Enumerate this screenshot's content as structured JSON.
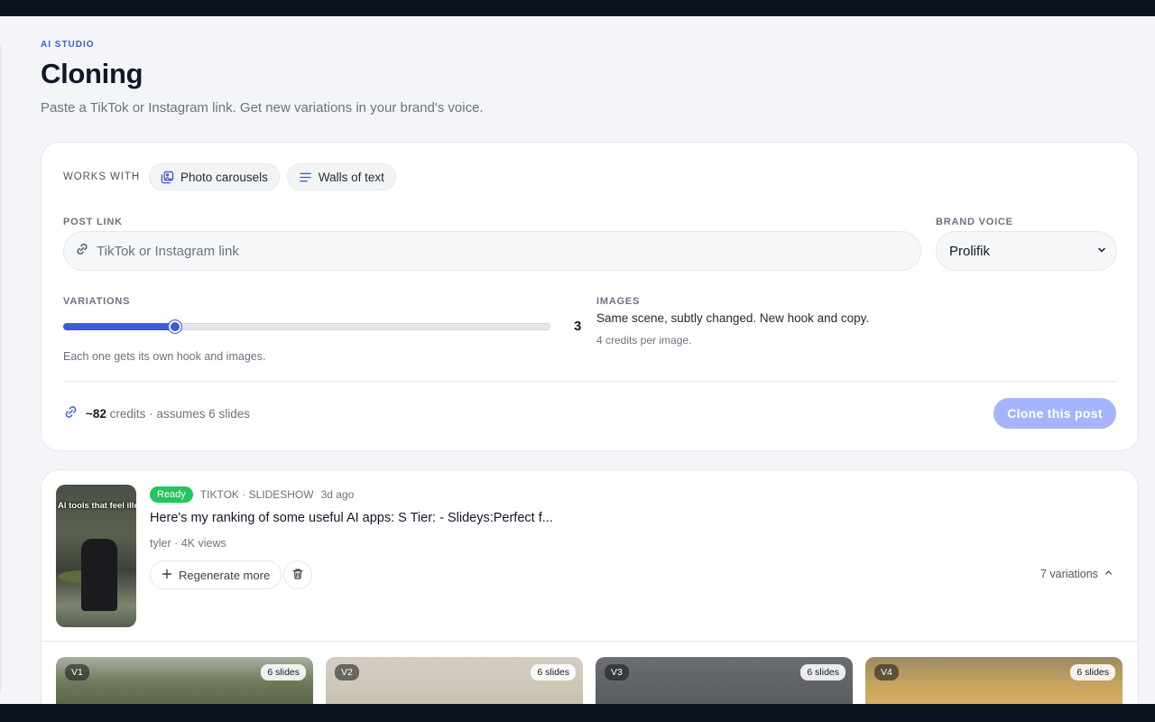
{
  "header": {
    "eyebrow": "AI STUDIO",
    "title": "Cloning",
    "subtitle": "Paste a TikTok or Instagram link. Get new variations in your brand's voice."
  },
  "form": {
    "works_with_label": "WORKS WITH",
    "chips": [
      {
        "label": "Photo carousels",
        "icon": "photo-carousel-icon"
      },
      {
        "label": "Walls of text",
        "icon": "text-lines-icon"
      }
    ],
    "post_link": {
      "label": "POST LINK",
      "value": "",
      "placeholder": "TikTok or Instagram link",
      "icon": "link-icon"
    },
    "brand_voice": {
      "label": "BRAND VOICE",
      "selected": "Prolifik",
      "icon": "chevron-down-icon"
    },
    "variations": {
      "label": "VARIATIONS",
      "value": 3,
      "display": "3",
      "min": 1,
      "max": 10,
      "help": "Each one gets its own hook and images."
    },
    "images": {
      "label": "IMAGES",
      "description": "Same scene, subtly changed. New hook and copy.",
      "credits": "4 credits per image."
    },
    "footer": {
      "credits_value": "~82",
      "credits_suffix": "credits · assumes 6 slides",
      "icon": "credits-link-icon"
    },
    "clone_button": "Clone this post"
  },
  "job": {
    "status": "Ready",
    "source": "TIKTOK · SLIDESHOW",
    "age": "3d ago",
    "thumbnail_overlay": "AI tools that feel illegal to know about",
    "title": "Here's my ranking of some useful AI apps: S Tier: - Slideys:Perfect f...",
    "author_views": "tyler · 4K views",
    "regenerate_label": "Regenerate more",
    "variations_count": "7 variations",
    "variations": [
      {
        "tag": "V1",
        "slides": "6 slides"
      },
      {
        "tag": "V2",
        "slides": "6 slides"
      },
      {
        "tag": "V3",
        "slides": "6 slides"
      },
      {
        "tag": "V4",
        "slides": "6 slides"
      }
    ]
  },
  "colors": {
    "accent": "#3b5bdb",
    "ready": "#22c55e",
    "clone_disabled": "#a5b4fc"
  }
}
